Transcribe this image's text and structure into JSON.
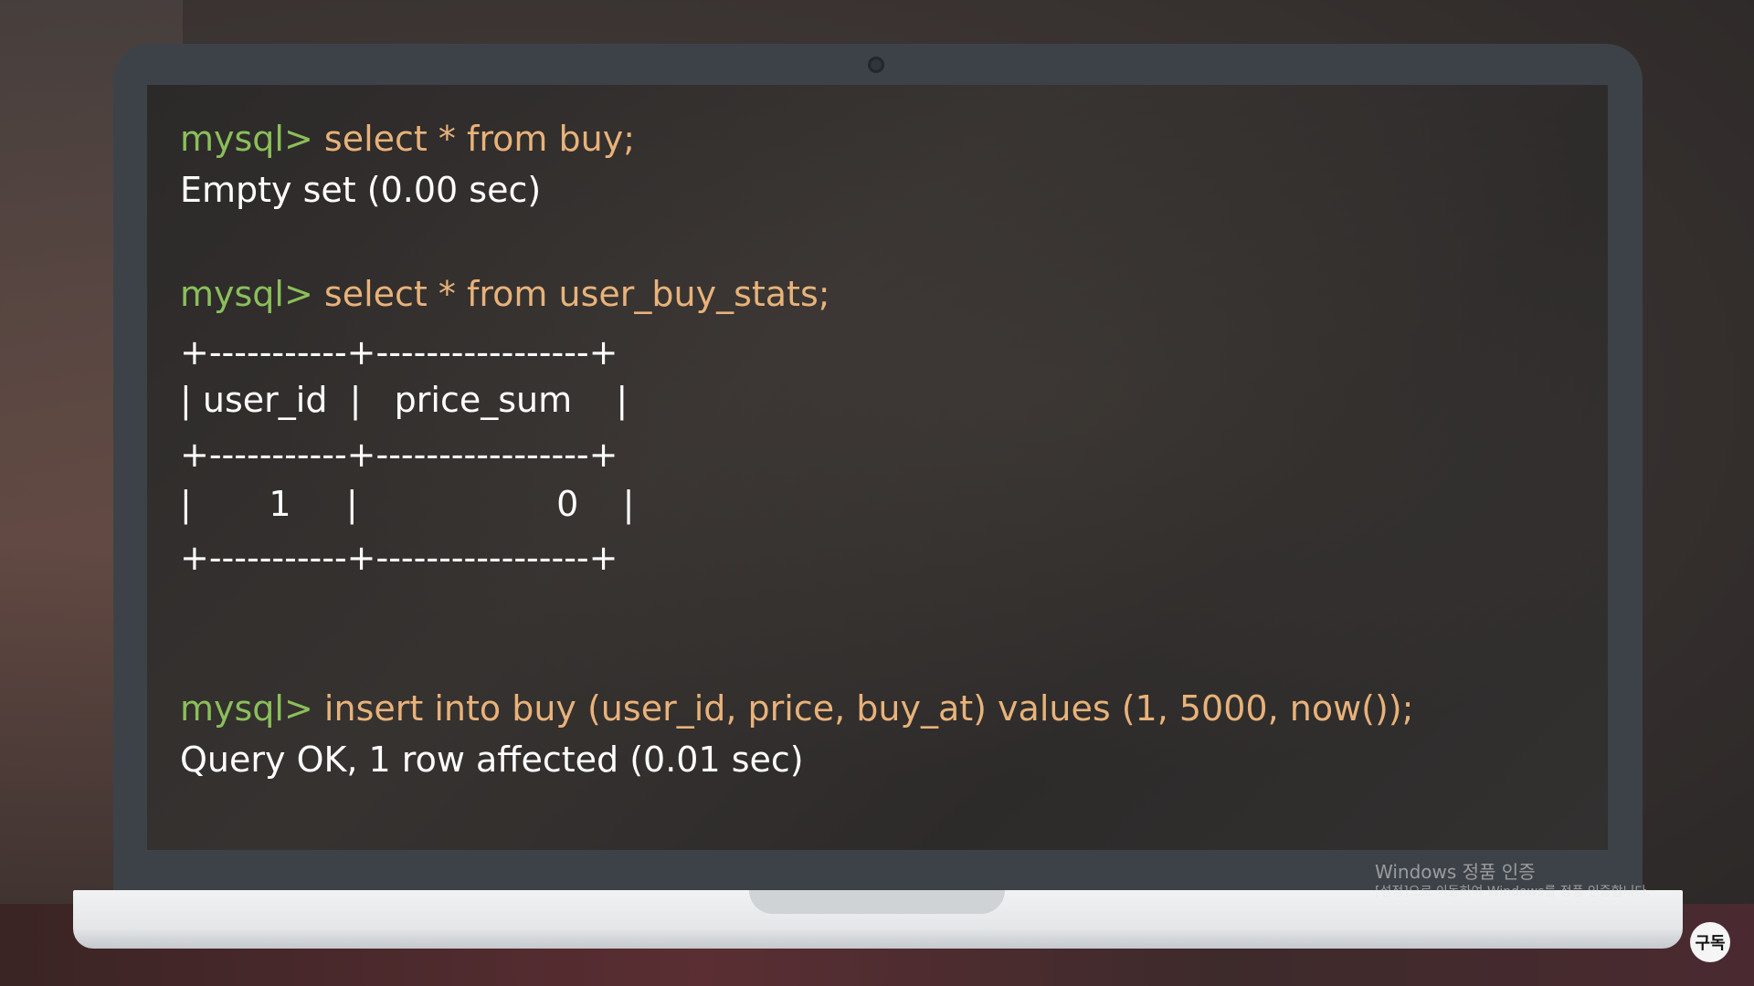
{
  "terminal": {
    "prompt": "mysql>",
    "block1": {
      "command": "select * from buy;",
      "output": "Empty set (0.00 sec)"
    },
    "block2": {
      "command": "select * from user_buy_stats;",
      "table": {
        "border": "+-----------+-----------------+",
        "header_row": "| user_id  |   price_sum    |",
        "data_row": "|       1     |                  0    |"
      }
    },
    "block3": {
      "command": "insert into buy (user_id, price, buy_at) values (1, 5000, now());",
      "output": "Query OK, 1 row affected (0.01 sec)"
    }
  },
  "watermark": {
    "title": "Windows 정품 인증",
    "subtitle": "[설정]으로 이동하여 Windows를 정품 인증합니다."
  },
  "subscribe": {
    "label": "구독"
  },
  "colors": {
    "prompt": "#8bbf5a",
    "command": "#e8b27a",
    "output": "#ffffff",
    "laptop_bezel": "#3d4248"
  }
}
